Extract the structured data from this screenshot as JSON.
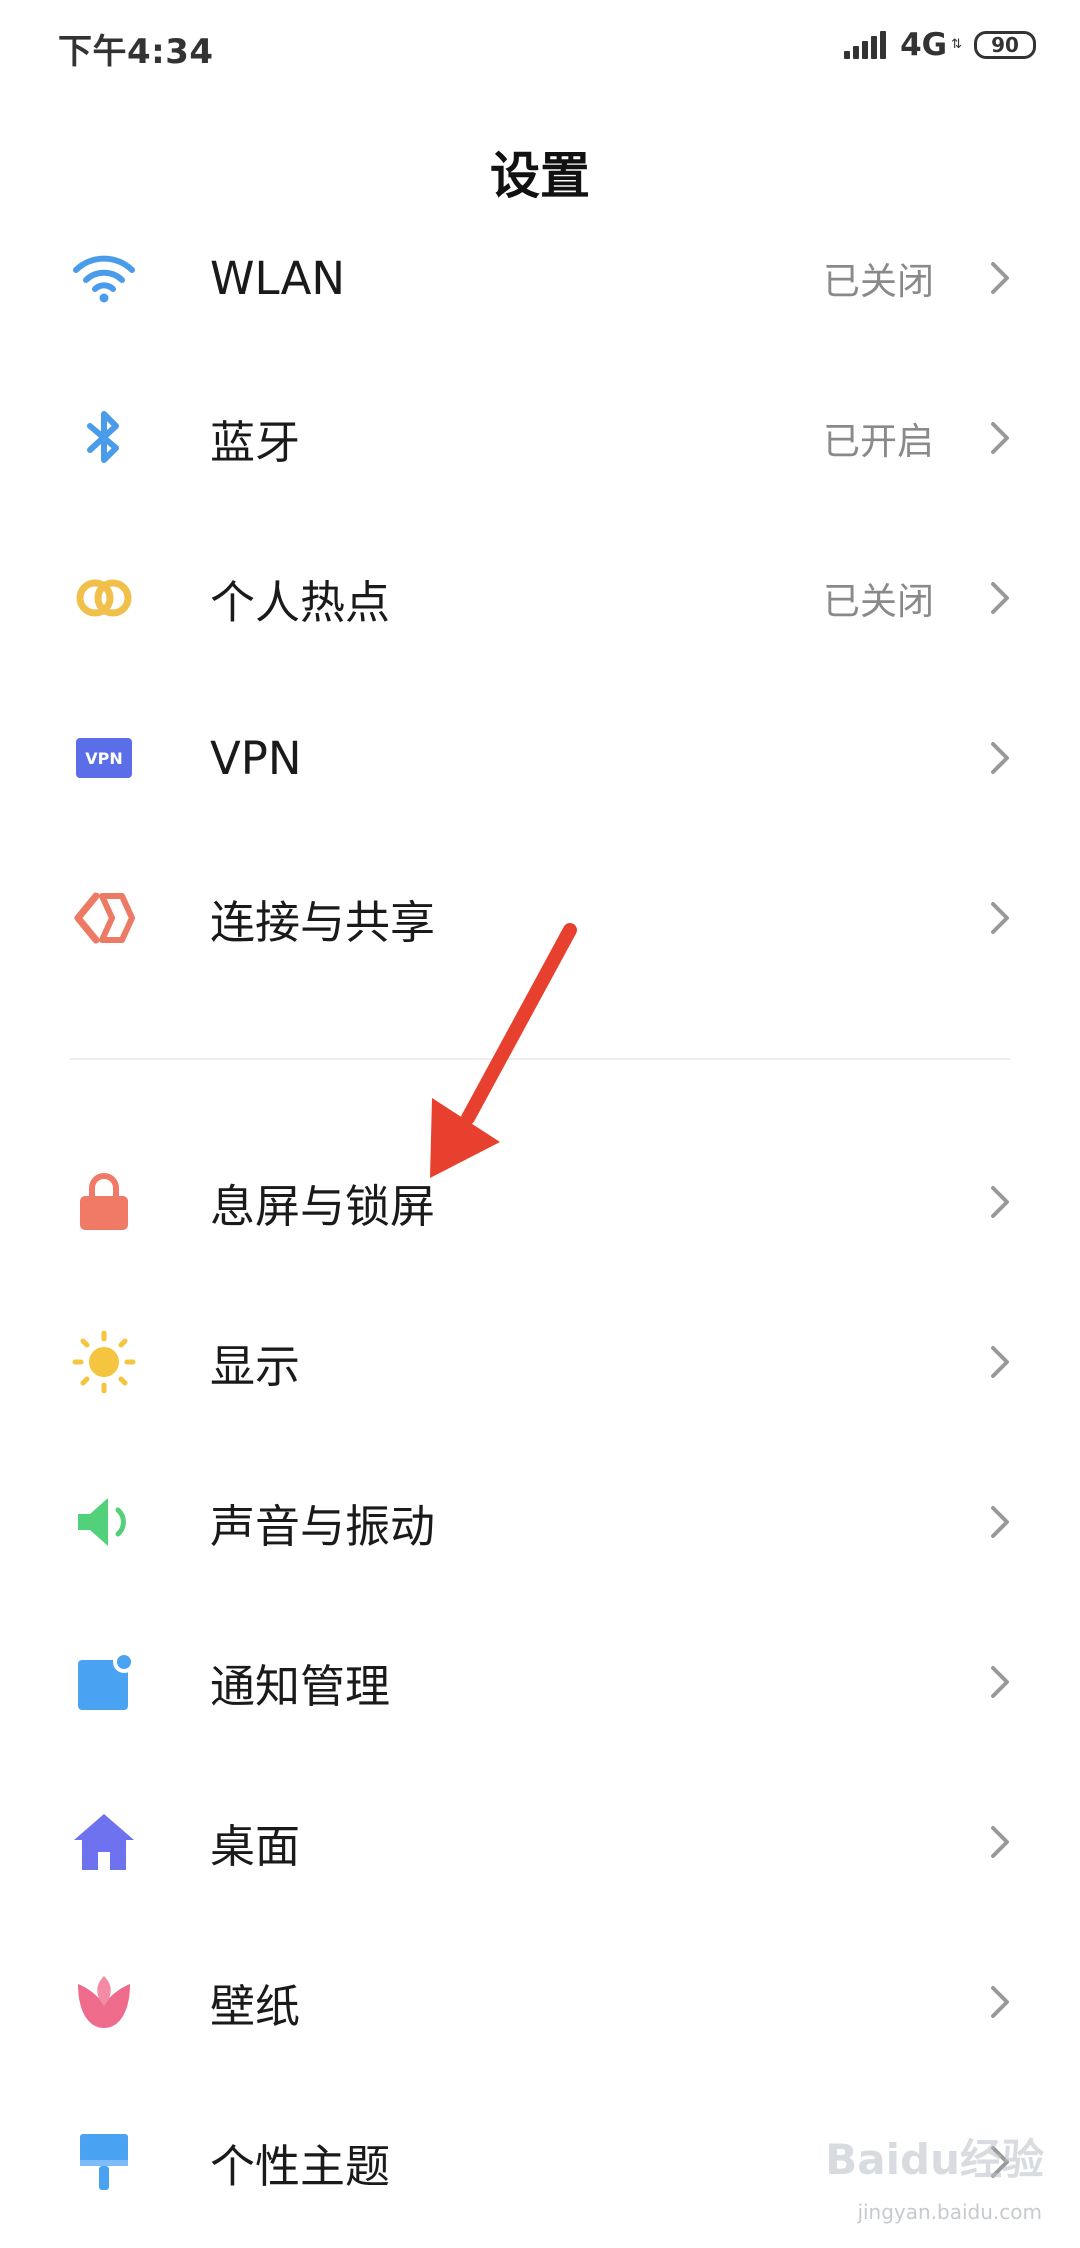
{
  "status_bar": {
    "time": "下午4:34",
    "network": "4G",
    "battery": "90"
  },
  "title": "设置",
  "settings": [
    {
      "label": "WLAN",
      "value": "已关闭",
      "icon": "wifi-icon",
      "color": "#4a9bea"
    },
    {
      "label": "蓝牙",
      "value": "已开启",
      "icon": "bluetooth-icon",
      "color": "#4a9bea"
    },
    {
      "label": "个人热点",
      "value": "已关闭",
      "icon": "hotspot-icon",
      "color": "#f0c04a"
    },
    {
      "label": "VPN",
      "value": "",
      "icon": "vpn-icon",
      "color": "#5a6ee8",
      "icon_text": "VPN"
    },
    {
      "label": "连接与共享",
      "value": "",
      "icon": "connection-share-icon",
      "color": "#ec7a64"
    },
    {
      "label": "息屏与锁屏",
      "value": "",
      "icon": "lock-icon",
      "color": "#f07a66"
    },
    {
      "label": "显示",
      "value": "",
      "icon": "brightness-icon",
      "color": "#f6c53f"
    },
    {
      "label": "声音与振动",
      "value": "",
      "icon": "speaker-icon",
      "color": "#53d07a"
    },
    {
      "label": "通知管理",
      "value": "",
      "icon": "notification-icon",
      "color": "#4aa3f2"
    },
    {
      "label": "桌面",
      "value": "",
      "icon": "home-icon",
      "color": "#6f72ee"
    },
    {
      "label": "壁纸",
      "value": "",
      "icon": "tulip-icon",
      "color": "#ee6b8c"
    },
    {
      "label": "个性主题",
      "value": "",
      "icon": "brush-icon",
      "color": "#4aa3f2"
    }
  ],
  "annotation": {
    "color": "#e8402e"
  },
  "watermark": {
    "logo": "Baidu经验",
    "url": "jingyan.baidu.com"
  }
}
